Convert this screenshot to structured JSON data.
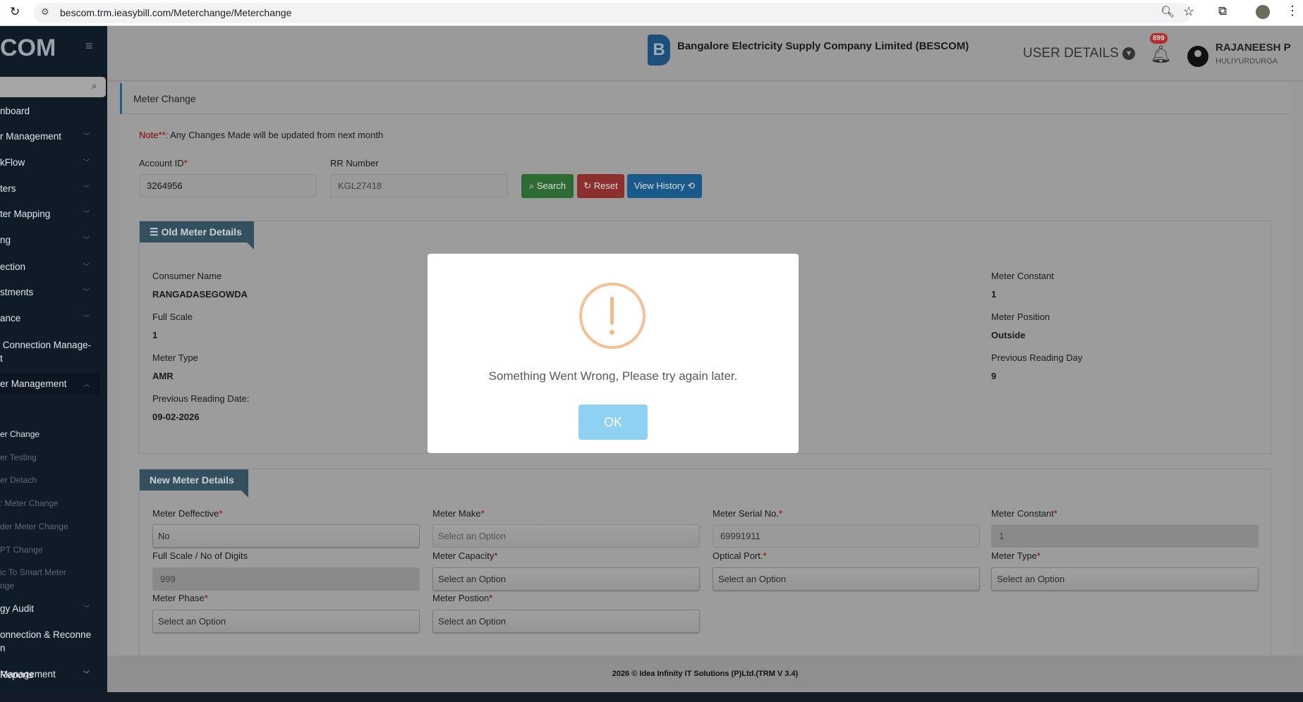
{
  "browser": {
    "url": "bescom.trm.ieasybill.com/Meterchange/Meterchange"
  },
  "sidebar": {
    "brand": "COM",
    "items": [
      {
        "label": "nboard"
      },
      {
        "label": "r Management"
      },
      {
        "label": "kFlow"
      },
      {
        "label": "ters"
      },
      {
        "label": "ter Mapping"
      },
      {
        "label": "ng"
      },
      {
        "label": "ection"
      },
      {
        "label": "stments"
      },
      {
        "label": "ance"
      },
      {
        "label": " Connection Manage-\nt"
      },
      {
        "label": "er Management"
      }
    ],
    "sub_items": [
      {
        "label": "er Change"
      },
      {
        "label": "er Testing"
      },
      {
        "label": "er Detach"
      },
      {
        "label": ": Meter Change"
      },
      {
        "label": "der Meter Change"
      },
      {
        "label": "PT Change"
      },
      {
        "label": "ic To Smart Meter"
      },
      {
        "label": "nge"
      }
    ],
    "bottom_items": [
      {
        "label": "gy Audit"
      },
      {
        "label": "onnection & Reconne"
      },
      {
        "label": "n"
      },
      {
        "label": " Management"
      },
      {
        "label": "Reports"
      }
    ]
  },
  "header": {
    "company": "Bangalore Electricity Supply Company Limited (BESCOM)",
    "logo_text": "BESCOM",
    "user_details": "USER DETAILS",
    "notifications": "899",
    "user_name": "RAJANEESH P",
    "user_location": "HULIYURDURGA"
  },
  "page": {
    "title": "Meter Change",
    "note_label": "Note**:",
    "note_text": " Any Changes Made will be updated from next month"
  },
  "search": {
    "account_label": "Account ID",
    "account_value": "3264956",
    "rr_label": "RR Number",
    "rr_value": "KGL27418",
    "search": "Search",
    "reset": "Reset",
    "history": "View History"
  },
  "old_meter": {
    "title": "Old Meter Details",
    "left": [
      {
        "label": "Consumer Name",
        "value": "RANGADASEGOWDA"
      },
      {
        "label": "Full Scale",
        "value": "1"
      },
      {
        "label": "Meter Type",
        "value": "AMR"
      },
      {
        "label": "Previous Reading Date:",
        "value": "09-02-2026"
      }
    ],
    "right": [
      {
        "label": "Meter Constant",
        "value": "1"
      },
      {
        "label": "Meter Position",
        "value": "Outside"
      },
      {
        "label": "Previous Reading Day",
        "value": "9"
      }
    ]
  },
  "new_meter": {
    "title": "New Meter Details",
    "fields": [
      {
        "label": "Meter Deffective",
        "value": "No"
      },
      {
        "label": "Meter Make",
        "value": "Select an Option"
      },
      {
        "label": "Meter Serial No.",
        "value": "69991911"
      },
      {
        "label": "Meter Constant",
        "value": "1"
      },
      {
        "label": "Full Scale / No of Digits",
        "value": "999"
      },
      {
        "label": "Meter Capacity",
        "value": "Select an Option"
      },
      {
        "label": "Optical Port.",
        "value": "Select an Option"
      },
      {
        "label": "Meter Type",
        "value": "Select an Option"
      },
      {
        "label": "Meter Phase",
        "value": "Select an Option"
      },
      {
        "label": "Meter Postion",
        "value": "Select an Option"
      }
    ]
  },
  "modal": {
    "message": "Something Went Wrong, Please try again later.",
    "ok": "OK"
  },
  "footer": {
    "text": "2026 © Idea Infinity IT Solutions (P)Ltd.(TRM V 3.4)"
  }
}
